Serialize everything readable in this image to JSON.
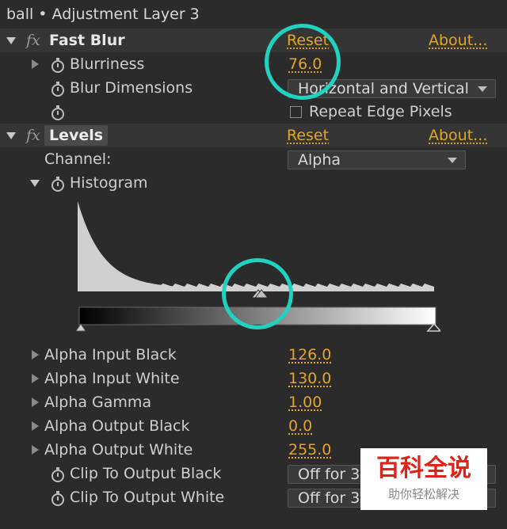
{
  "panel_title": "ball • Adjustment Layer 3",
  "fast_blur": {
    "fx_label": "fx",
    "name": "Fast Blur",
    "reset": "Reset",
    "about": "About...",
    "blurriness_label": "Blurriness",
    "blurriness_value": "76.0",
    "blur_dimensions_label": "Blur Dimensions",
    "blur_dimensions_value": "Horizontal and Vertical",
    "repeat_edge_label": "Repeat Edge Pixels"
  },
  "levels": {
    "fx_label": "fx",
    "name": "Levels",
    "reset": "Reset",
    "about": "About...",
    "channel_label": "Channel:",
    "channel_value": "Alpha",
    "histogram_label": "Histogram",
    "properties": [
      {
        "label": "Alpha Input Black",
        "value": "126.0"
      },
      {
        "label": "Alpha Input White",
        "value": "130.0"
      },
      {
        "label": "Alpha Gamma",
        "value": "1.00"
      },
      {
        "label": "Alpha Output Black",
        "value": "0.0"
      },
      {
        "label": "Alpha Output White",
        "value": "255.0"
      }
    ],
    "clip_black_label": "Clip To Output Black",
    "clip_black_value": "Off for 3",
    "clip_white_label": "Clip To Output White",
    "clip_white_value": "Off for 3"
  },
  "watermark": {
    "title": "百科全说",
    "subtitle": "助你轻松解决"
  },
  "colors": {
    "accent": "#e3a52b",
    "highlight_circle": "#22d2c0",
    "background": "#2b2b2b"
  }
}
